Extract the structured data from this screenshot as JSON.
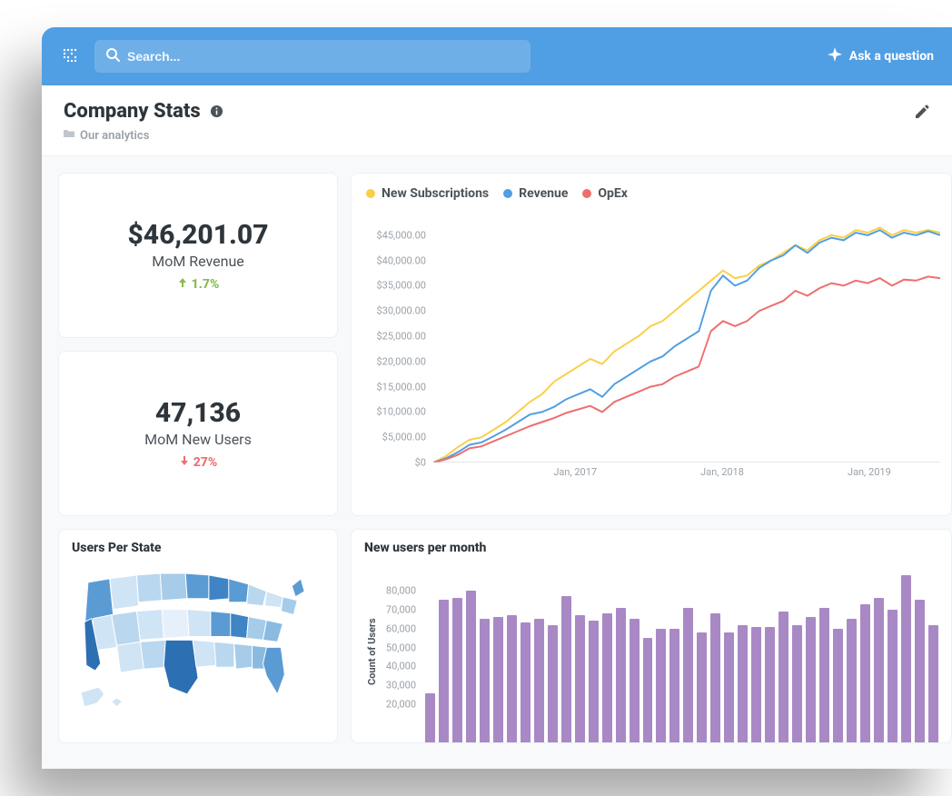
{
  "topbar": {
    "search_placeholder": "Search...",
    "ask_label": "Ask a question"
  },
  "header": {
    "title": "Company Stats",
    "breadcrumb": "Our analytics"
  },
  "kpis": [
    {
      "value": "$46,201.07",
      "label": "MoM Revenue",
      "change": "1.7%",
      "direction": "up"
    },
    {
      "value": "47,136",
      "label": "MoM New Users",
      "change": "27%",
      "direction": "down"
    }
  ],
  "linechart_title_legend": [
    {
      "name": "New Subscriptions",
      "color": "#f9cf48"
    },
    {
      "name": "Revenue",
      "color": "#509ee3"
    },
    {
      "name": "OpEx",
      "color": "#ed6e6e"
    }
  ],
  "chart_data": [
    {
      "type": "line",
      "title": "",
      "xlabel": "",
      "ylabel": "",
      "ylim": [
        0,
        50000
      ],
      "y_ticks": [
        "$0",
        "$5,000.00",
        "$10,000.00",
        "$15,000.00",
        "$20,000.00",
        "$25,000.00",
        "$30,000.00",
        "$35,000.00",
        "$40,000.00",
        "$45,000.00"
      ],
      "x_ticks": [
        "Jan, 2017",
        "Jan, 2018",
        "Jan, 2019"
      ],
      "x": [
        0,
        1,
        2,
        3,
        4,
        5,
        6,
        7,
        8,
        9,
        10,
        11,
        12,
        13,
        14,
        15,
        16,
        17,
        18,
        19,
        20,
        21,
        22,
        23,
        24,
        25,
        26,
        27,
        28,
        29,
        30,
        31,
        32,
        33,
        34,
        35,
        36,
        37,
        38,
        39,
        40,
        41,
        42
      ],
      "series": [
        {
          "name": "New Subscriptions",
          "color": "#f9cf48",
          "values": [
            0,
            1200,
            3000,
            4500,
            5000,
            6500,
            8000,
            10000,
            12000,
            13500,
            16000,
            17500,
            19000,
            20500,
            19500,
            22000,
            23500,
            25000,
            27000,
            28000,
            30000,
            32000,
            34000,
            36000,
            38000,
            36500,
            37000,
            39000,
            40000,
            41500,
            43000,
            42000,
            44000,
            45000,
            44500,
            46000,
            45500,
            46500,
            45000,
            46000,
            45500,
            46000,
            45500
          ]
        },
        {
          "name": "Revenue",
          "color": "#509ee3",
          "values": [
            0,
            800,
            2000,
            3500,
            4000,
            5200,
            6500,
            8000,
            9500,
            10000,
            11000,
            12500,
            13500,
            14500,
            13000,
            15500,
            17000,
            18500,
            20000,
            21000,
            23000,
            24500,
            26000,
            34000,
            37000,
            35000,
            36000,
            38500,
            40000,
            41000,
            43000,
            41500,
            43500,
            44500,
            44000,
            45500,
            45000,
            46000,
            44500,
            45500,
            45000,
            45800,
            45000
          ]
        },
        {
          "name": "OpEx",
          "color": "#ed6e6e",
          "values": [
            0,
            600,
            1500,
            2800,
            3200,
            4200,
            5200,
            6200,
            7200,
            8000,
            8800,
            9800,
            10500,
            11200,
            10000,
            12000,
            13000,
            14000,
            15000,
            15500,
            17000,
            18000,
            19000,
            26000,
            28000,
            27000,
            28000,
            30000,
            31000,
            32000,
            34000,
            33000,
            34500,
            35500,
            35000,
            36000,
            35500,
            36500,
            35000,
            36200,
            36000,
            36800,
            36500
          ]
        }
      ]
    },
    {
      "type": "bar",
      "title": "New users per month",
      "xlabel": "",
      "ylabel": "Count of Users",
      "ylim": [
        0,
        90000
      ],
      "y_ticks": [
        "20,000",
        "30,000",
        "40,000",
        "50,000",
        "60,000",
        "70,000",
        "80,000"
      ],
      "values": [
        26000,
        75000,
        76000,
        80000,
        65000,
        66000,
        67000,
        63000,
        65000,
        62000,
        77000,
        67000,
        64000,
        68000,
        71000,
        65000,
        55000,
        60000,
        60000,
        71000,
        58000,
        68000,
        58000,
        62000,
        61000,
        61000,
        69000,
        62000,
        66000,
        71000,
        60000,
        65000,
        73000,
        76000,
        70000,
        88000,
        75000,
        62000
      ]
    }
  ],
  "map_card": {
    "title": "Users Per State"
  },
  "bar_card": {
    "title": "New users per month",
    "ylabel": "Count of Users"
  },
  "colors": {
    "brand": "#509ee3",
    "positive": "#84bb4c",
    "negative": "#ed6e6e",
    "bar": "#a989c5"
  }
}
